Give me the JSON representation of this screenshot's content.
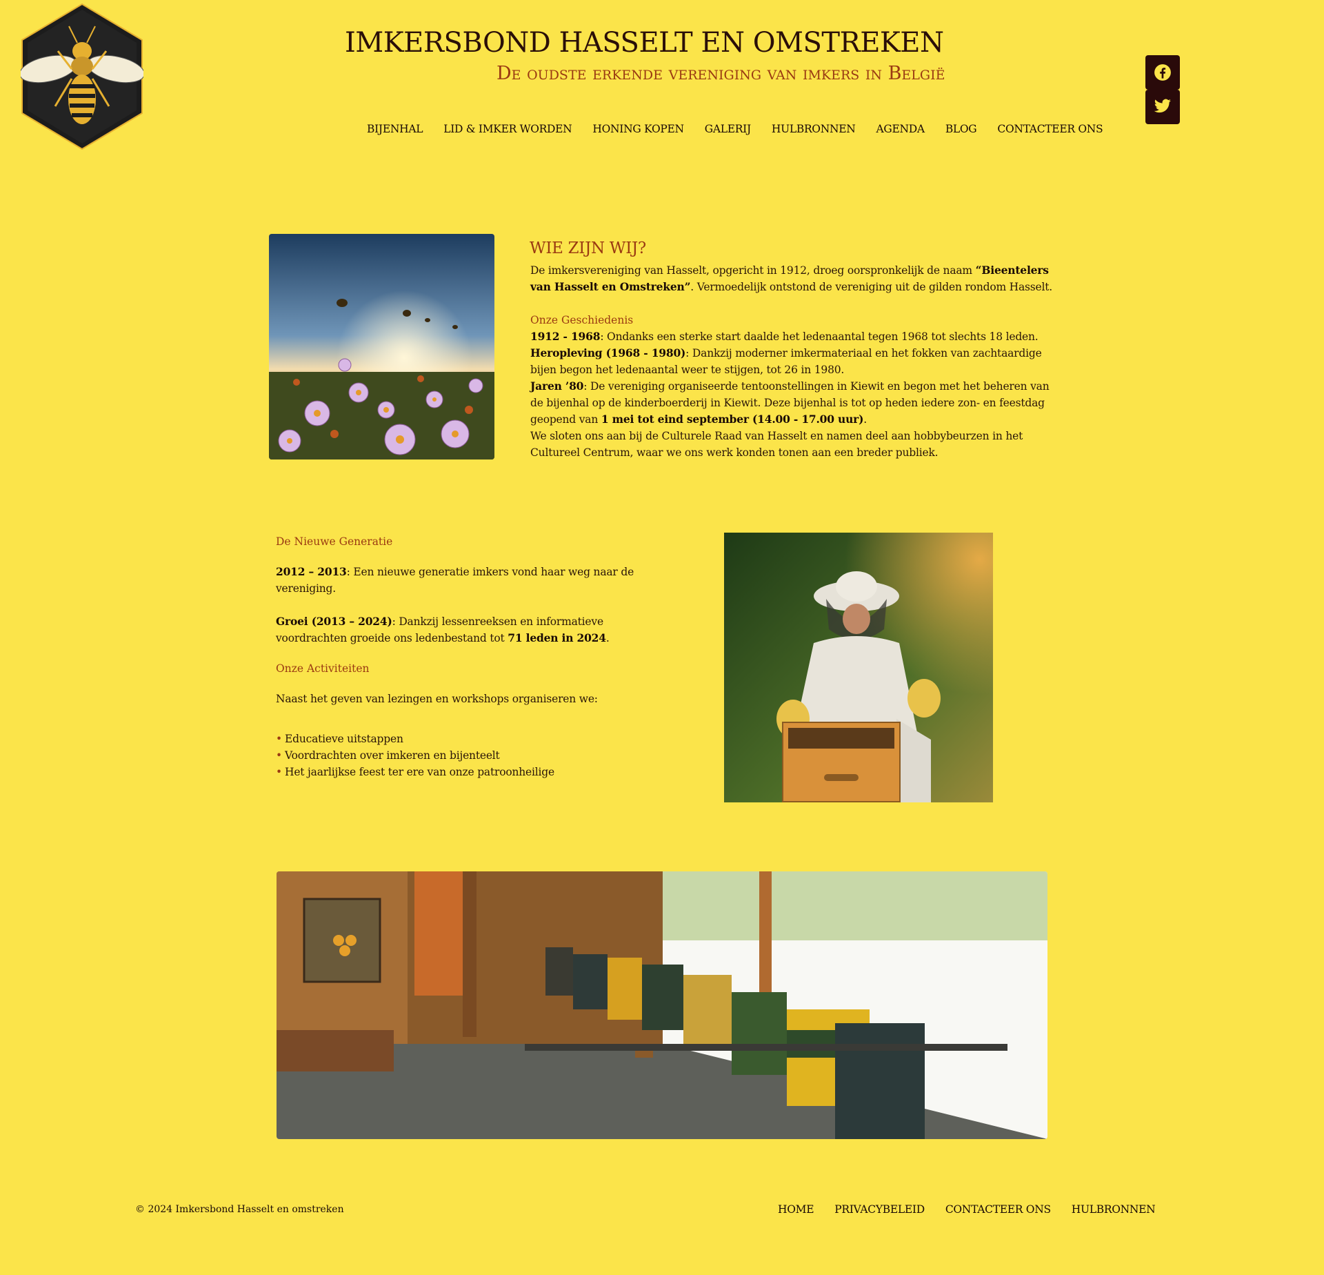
{
  "header": {
    "title": "IMKERSBOND HASSELT EN OMSTREKEN",
    "tagline": "De oudste erkende vereniging van imkers in België"
  },
  "nav": {
    "items": [
      "BIJENHAL",
      "LID & IMKER WORDEN",
      "HONING KOPEN",
      "GALERIJ",
      "HULBRONNEN",
      "AGENDA",
      "BLOG",
      "CONTACTEER ONS"
    ]
  },
  "social": {
    "icons": [
      "facebook-icon",
      "twitter-icon"
    ]
  },
  "colors": {
    "background": "#fbe44a",
    "accent": "#9a3a12",
    "dark": "#2a0a0a"
  },
  "about": {
    "heading": "WIE ZIJN WIJ?",
    "intro_1": "De imkersvereniging van Hasselt, opgericht in 1912, droeg oorspronkelijk de naam ",
    "intro_bold": "“Bieentelers van Hasselt en Omstreken”",
    "intro_2": ". Vermoedelijk ontstond de vereniging uit de gilden rondom Hasselt.",
    "history_heading": "Onze Geschiedenis",
    "h1_bold": "1912 - 1968",
    "h1_text": ": Ondanks een sterke start daalde het ledenaantal tegen 1968 tot slechts 18 leden.",
    "h2_bold": "Heropleving (1968 - 1980)",
    "h2_text": ": Dankzij moderner imkermateriaal en het fokken van zachtaardige bijen begon het ledenaantal weer te stijgen, tot 26 in 1980.",
    "h3_bold": "Jaren ’80",
    "h3_text": ": De vereniging organiseerde tentoonstellingen in Kiewit en begon met het beheren van de bijenhal op de kinderboerderij in Kiewit. Deze bijenhal is tot op heden iedere zon- en feestdag geopend van ",
    "h3_bold2": "1 mei tot eind september (14.00 - 17.00 uur)",
    "h3_end": ".",
    "h4_text": "We sloten ons aan bij de Culturele Raad van Hasselt en namen deel aan hobbybeurzen in het Cultureel Centrum, waar we ons werk konden tonen aan een breder publiek."
  },
  "generation": {
    "heading": "De Nieuwe Generatie",
    "g1_bold": "2012 – 2013",
    "g1_text": ": Een nieuwe generatie imkers vond haar weg naar de vereniging.",
    "g2_bold": "Groei (2013 – 2024)",
    "g2_text": ": Dankzij lessenreeksen en informatieve voordrachten groeide ons ledenbestand tot ",
    "g2_bold2": "71 leden in 2024",
    "g2_end": ".",
    "activities_heading": "Onze Activiteiten",
    "activities_intro": "Naast het geven van lezingen en workshops organiseren we:",
    "activities": [
      "Educatieve uitstappen",
      "Voordrachten over imkeren en bijenteelt",
      "Het jaarlijkse feest ter ere van onze patroonheilige"
    ]
  },
  "footer": {
    "copyright": "© 2024 Imkersbond Hasselt en omstreken",
    "links": [
      "HOME",
      "PRIVACYBELEID",
      "CONTACTEER ONS",
      "HULBRONNEN"
    ]
  }
}
